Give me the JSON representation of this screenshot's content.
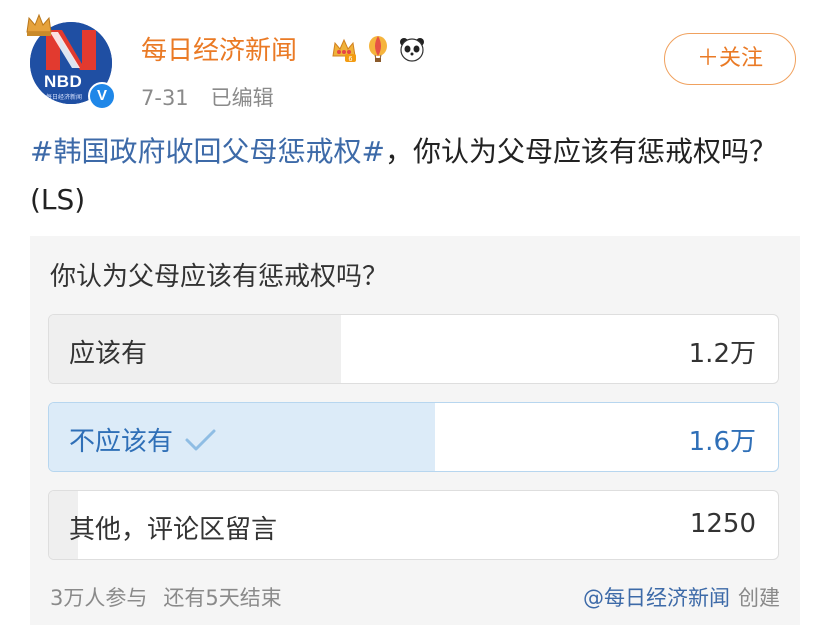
{
  "account": {
    "name": "每日经济新闻",
    "avatar_text": "NBD",
    "avatar_subtext": "每日经济新闻",
    "verified_mark": "V",
    "badges": [
      "crown-badge-icon",
      "balloon-badge-icon",
      "panda-badge-icon"
    ],
    "date": "7-31",
    "edited": "已编辑"
  },
  "follow_button": {
    "label": "＋关注"
  },
  "post": {
    "hashtag": "#韩国政府收回父母惩戒权#",
    "text": "，你认为父母应该有惩戒权吗？(LS)"
  },
  "poll": {
    "question": "你认为父母应该有惩戒权吗？",
    "options": [
      {
        "label": "应该有",
        "count": "1.2万",
        "share": 0.4,
        "selected": false
      },
      {
        "label": "不应该有",
        "count": "1.6万",
        "share": 0.53,
        "selected": true
      },
      {
        "label": "其他，评论区留言",
        "count": "1250",
        "share": 0.04,
        "selected": false
      }
    ],
    "participants": "3万人参与",
    "remaining": "还有5天结束",
    "creator": "@每日经济新闻",
    "creator_suffix": "创建"
  },
  "colors": {
    "username": "#ea7a25",
    "link": "#3d6aa8",
    "selected_fill": "#dcebf8",
    "unselected_fill": "#efefef"
  }
}
